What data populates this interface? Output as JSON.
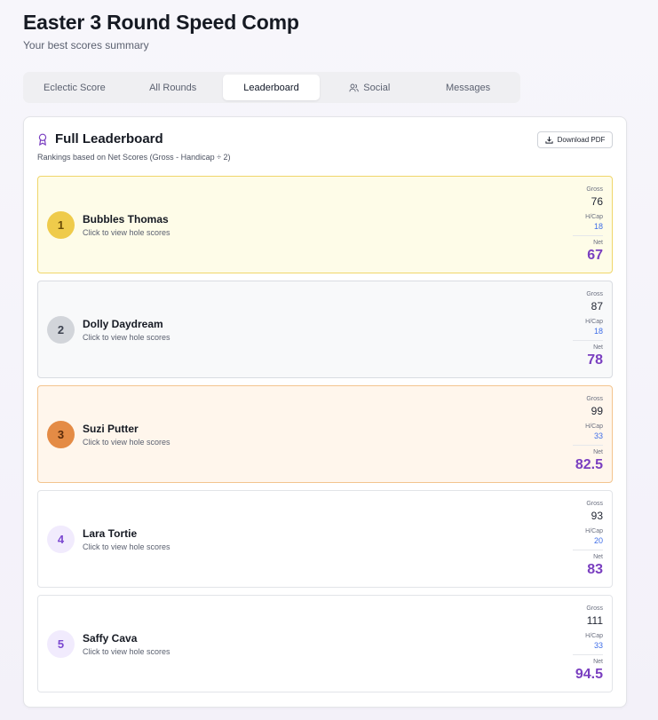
{
  "header": {
    "title": "Easter 3 Round Speed Comp",
    "subtitle": "Your best scores summary"
  },
  "tabs": [
    {
      "label": "Eclectic Score",
      "active": false
    },
    {
      "label": "All Rounds",
      "active": false
    },
    {
      "label": "Leaderboard",
      "active": true
    },
    {
      "label": "Social",
      "active": false,
      "icon": "users-icon"
    },
    {
      "label": "Messages",
      "active": false
    }
  ],
  "leaderboard": {
    "title": "Full Leaderboard",
    "title_icon": "award-icon",
    "subtitle": "Rankings based on Net Scores (Gross - Handicap ÷ 2)",
    "download_label": "Download PDF",
    "download_icon": "download-icon",
    "labels": {
      "gross": "Gross",
      "handicap": "H/Cap",
      "net": "Net"
    },
    "hint": "Click to view hole scores",
    "players": [
      {
        "rank": "1",
        "name": "Bubbles Thomas",
        "gross": "76",
        "handicap": "18",
        "net": "67"
      },
      {
        "rank": "2",
        "name": "Dolly Daydream",
        "gross": "87",
        "handicap": "18",
        "net": "78"
      },
      {
        "rank": "3",
        "name": "Suzi Putter",
        "gross": "99",
        "handicap": "33",
        "net": "82.5"
      },
      {
        "rank": "4",
        "name": "Lara Tortie",
        "gross": "93",
        "handicap": "20",
        "net": "83"
      },
      {
        "rank": "5",
        "name": "Saffy Cava",
        "gross": "111",
        "handicap": "33",
        "net": "94.5"
      }
    ]
  },
  "colors": {
    "accent_purple": "#7a3fc0",
    "handicap_blue": "#3f6ee8",
    "gold": "#efcb4b",
    "silver": "#d2d5da",
    "bronze": "#e48b45"
  }
}
